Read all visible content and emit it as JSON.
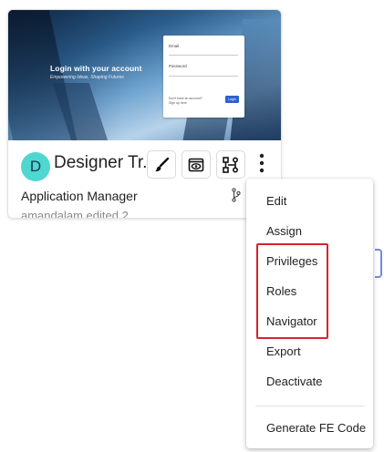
{
  "card": {
    "thumbnail": {
      "heading": "Login with your account",
      "subheading": "Empowering Ideas, Shaping Futures",
      "form": {
        "field1_label": "Email",
        "field2_label": "Password",
        "footer_text": "Don't have an account? Sign up here",
        "button_label": "Login"
      }
    },
    "avatar_letter": "D",
    "app_name": "Designer Tr...",
    "role": "Application Manager",
    "edited_by": "amandalam edited 2"
  },
  "actions": {
    "paint_icon": "paintbrush-icon",
    "preview_icon": "preview-eye-icon",
    "flow_icon": "workflow-icon",
    "more_icon": "more-vertical-icon"
  },
  "menu": {
    "items": [
      {
        "label": "Edit"
      },
      {
        "label": "Assign"
      },
      {
        "label": "Privileges"
      },
      {
        "label": "Roles"
      },
      {
        "label": "Navigator"
      },
      {
        "label": "Export"
      },
      {
        "label": "Deactivate"
      },
      {
        "label": "Generate FE Code"
      }
    ],
    "highlight_color": "#d8232a"
  },
  "colors": {
    "avatar_bg": "#4fd7d0",
    "accent": "#2f5fd0"
  }
}
